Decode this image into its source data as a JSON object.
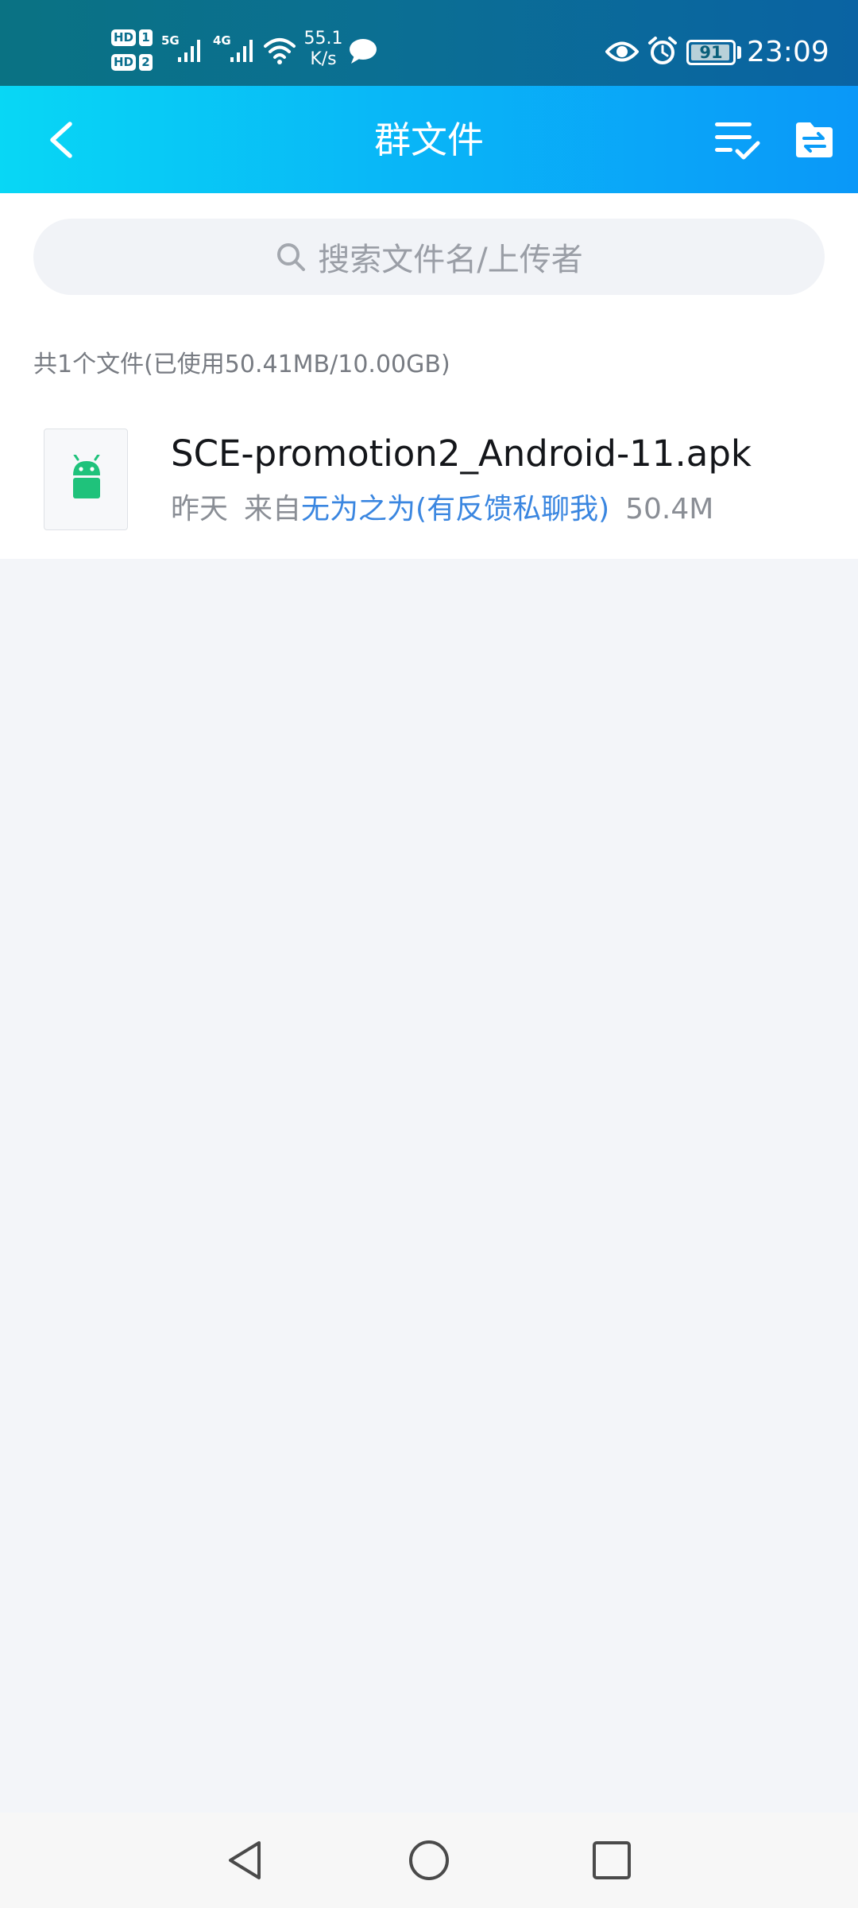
{
  "status_bar": {
    "sim1_badge": "HD",
    "sim1_num": "1",
    "sim2_badge": "HD",
    "sim2_num": "2",
    "net1_type": "5G",
    "net2_type": "4G",
    "speed_value": "55.1",
    "speed_unit": "K/s",
    "battery_level": "91",
    "time": "23:09",
    "icons": [
      "signal-icon",
      "wifi-icon",
      "message-bubble-icon",
      "eye-icon",
      "alarm-icon",
      "battery-icon"
    ]
  },
  "header": {
    "title": "群文件",
    "icons": [
      "back-icon",
      "multi-select-icon",
      "folder-transfer-icon"
    ]
  },
  "search": {
    "placeholder": "搜索文件名/上传者"
  },
  "summary": {
    "text": "共1个文件(已使用50.41MB/10.00GB)"
  },
  "files": [
    {
      "name": "SCE-promotion2_Android-11.apk",
      "date": "昨天",
      "from_label": "来自",
      "uploader": "无为之为(有反馈私聊我)",
      "size": "50.4M",
      "icon": "android-icon",
      "icon_color": "#1fc27b"
    }
  ],
  "nav_bar": {
    "icons": [
      "back-triangle-icon",
      "home-circle-icon",
      "recents-square-icon"
    ]
  },
  "colors": {
    "header_start": "#08d7f5",
    "header_end": "#0a98f8",
    "link": "#3a86e0",
    "background": "#f3f5f9"
  }
}
